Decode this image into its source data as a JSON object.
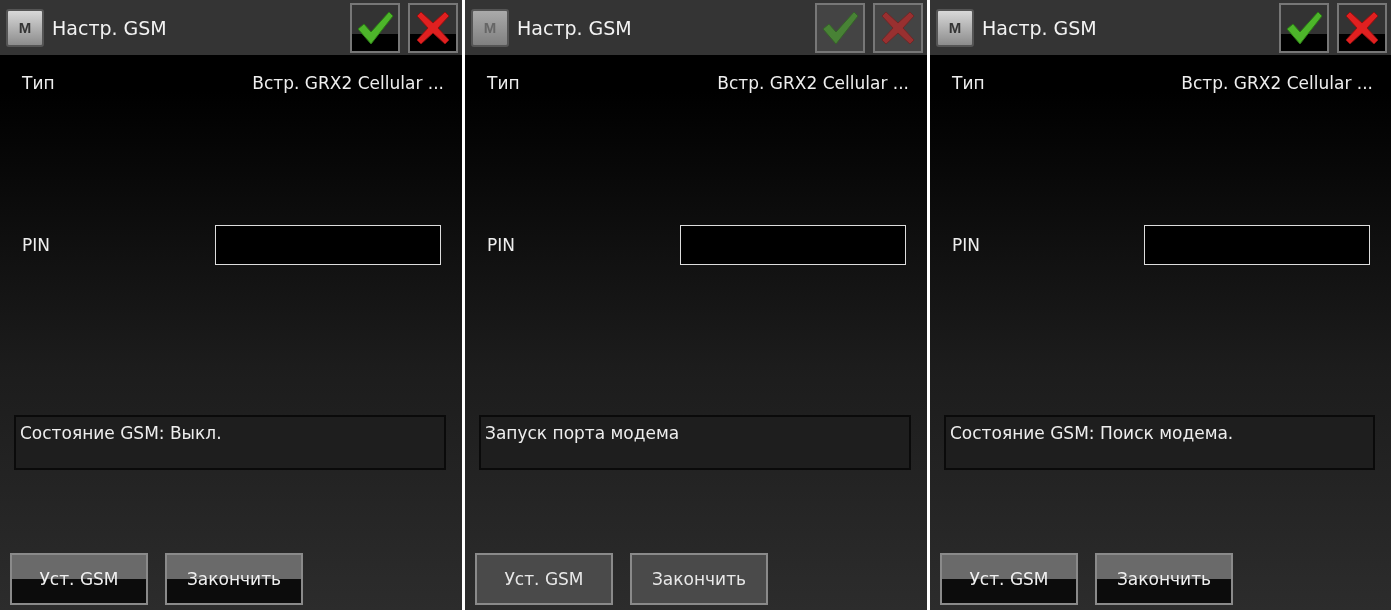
{
  "panels": [
    {
      "menu_key": "M",
      "title": "Настр. GSM",
      "disabled": false,
      "type_label": "Тип",
      "type_value": "Встр. GRX2 Cellular ...",
      "pin_label": "PIN",
      "status": "Состояние GSM: Выкл.",
      "buttons": [
        "Уст. GSM",
        "Закончить"
      ]
    },
    {
      "menu_key": "M",
      "title": "Настр. GSM",
      "disabled": true,
      "type_label": "Тип",
      "type_value": "Встр. GRX2 Cellular ...",
      "pin_label": "PIN",
      "status": "Запуск порта модема",
      "buttons": [
        "Уст. GSM",
        "Закончить"
      ]
    },
    {
      "menu_key": "M",
      "title": "Настр. GSM",
      "disabled": false,
      "type_label": "Тип",
      "type_value": "Встр. GRX2 Cellular ...",
      "pin_label": "PIN",
      "status": "Состояние GSM: Поиск модема.",
      "buttons": [
        "Уст. GSM",
        "Закончить"
      ]
    }
  ]
}
